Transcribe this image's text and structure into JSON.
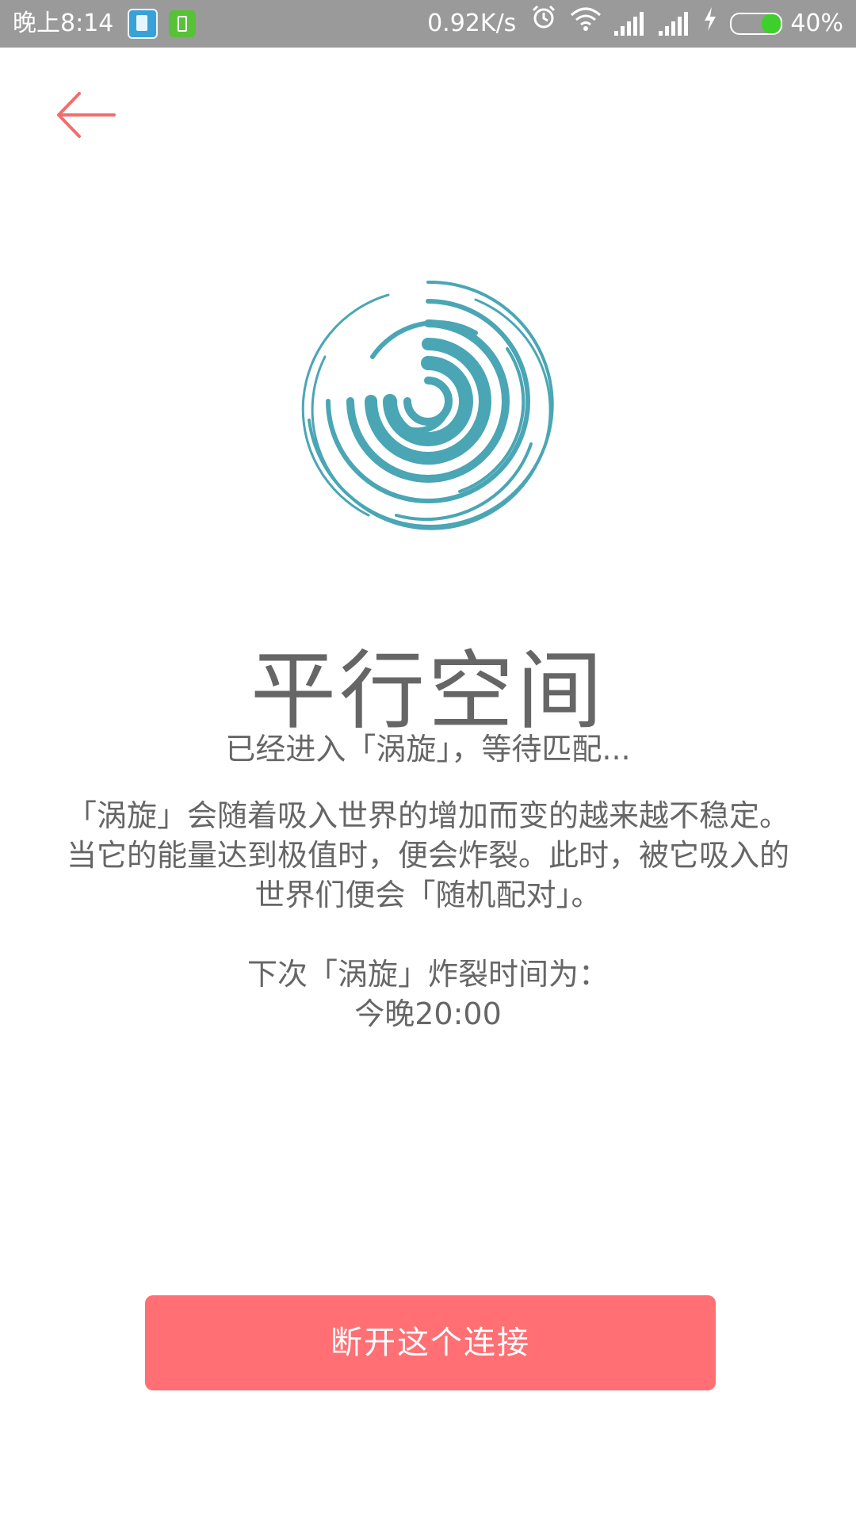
{
  "status_bar": {
    "time": "晚上8:14",
    "speed": "0.92K/s",
    "battery_text": "40%",
    "battery_level": 0.4,
    "icons": [
      "book-app-icon",
      "battery-app-icon",
      "alarm-icon",
      "wifi-icon",
      "signal-icon",
      "signal-icon",
      "charging-icon",
      "battery-icon"
    ]
  },
  "header": {
    "back_icon": "back-arrow-icon",
    "accent_color": "#f26d6d"
  },
  "logo": {
    "icon": "vortex-icon",
    "color": "#4aa6b4"
  },
  "main": {
    "title": "平行空间",
    "subtitle": "已经进入「涡旋」，等待匹配...",
    "description": "「涡旋」会随着吸入世界的增加而变的越来越不稳定。当它的能量达到极值时，便会炸裂。此时，被它吸入的世界们便会「随机配对」。",
    "next_label": "下次「涡旋」炸裂时间为：",
    "next_time": "今晚20:00"
  },
  "actions": {
    "disconnect_label": "断开这个连接",
    "button_color": "#ff6f74"
  }
}
